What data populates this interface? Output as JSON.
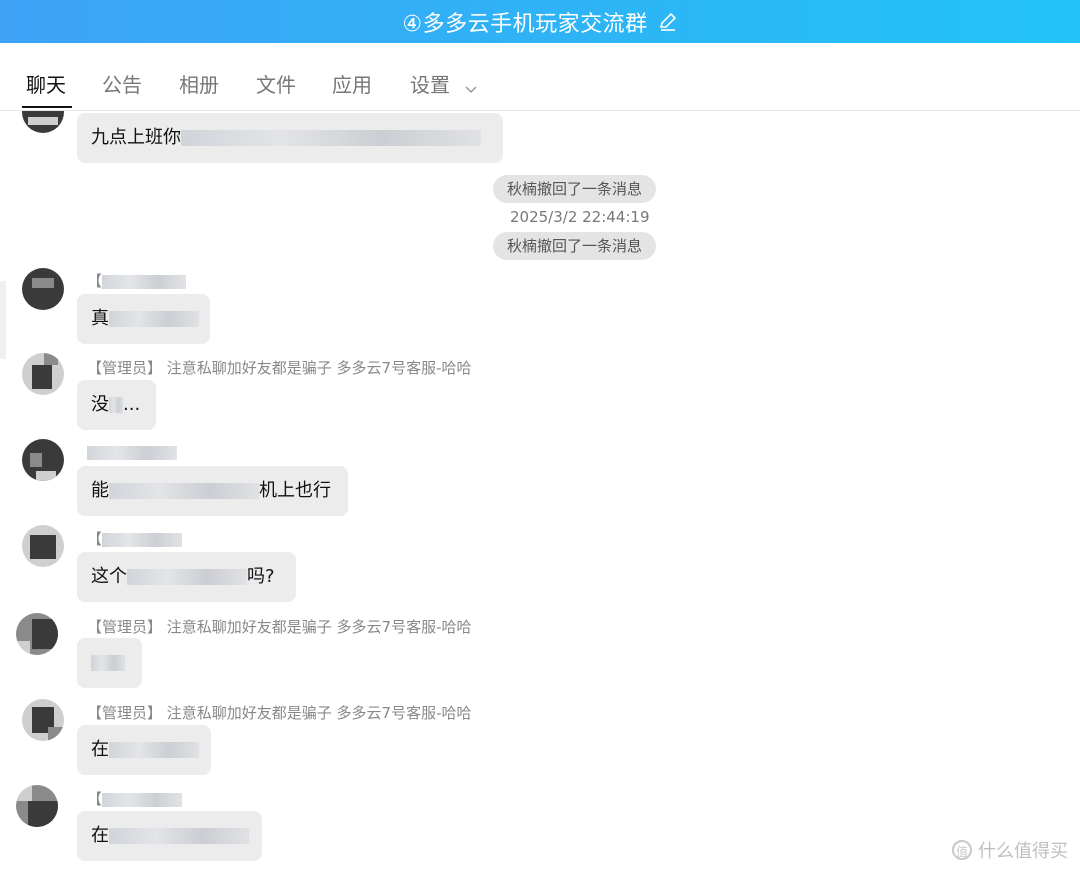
{
  "window": {
    "title": "④多多云手机玩家交流群"
  },
  "tabs": [
    {
      "label": "聊天",
      "active": true
    },
    {
      "label": "公告",
      "active": false
    },
    {
      "label": "相册",
      "active": false
    },
    {
      "label": "文件",
      "active": false
    },
    {
      "label": "应用",
      "active": false
    },
    {
      "label": "设置",
      "active": false
    }
  ],
  "messages": {
    "m0": {
      "text": "九点上班你"
    },
    "sys1": {
      "text": "秋楠撤回了一条消息"
    },
    "time1": {
      "text": "2025/3/2 22:44:19"
    },
    "sys2": {
      "text": "秋楠撤回了一条消息"
    },
    "m1": {
      "name": "【",
      "text": "真"
    },
    "m2": {
      "name": "【管理员】 注意私聊加好友都是骗子 多多云7号客服-哈哈",
      "text": "没...",
      "text_pre": "没",
      "text_post": "..."
    },
    "m3": {
      "name": "",
      "text_pre": "能",
      "text_post": "机上也行"
    },
    "m4": {
      "name": "【",
      "text_pre": "这个",
      "text_post": "吗?"
    },
    "m5": {
      "name": "【管理员】 注意私聊加好友都是骗子 多多云7号客服-哈哈",
      "text": ""
    },
    "m6": {
      "name": "【管理员】 注意私聊加好友都是骗子 多多云7号客服-哈哈",
      "text_pre": "在",
      "text_post": ""
    },
    "m7": {
      "name": "【",
      "text_pre": "在",
      "text_post": ""
    }
  },
  "watermark": {
    "text": "什么值得买"
  },
  "colors": {
    "title_bar": "#3ea2f7",
    "bubble": "#ececec",
    "system_pill": "#e4e4e4"
  }
}
